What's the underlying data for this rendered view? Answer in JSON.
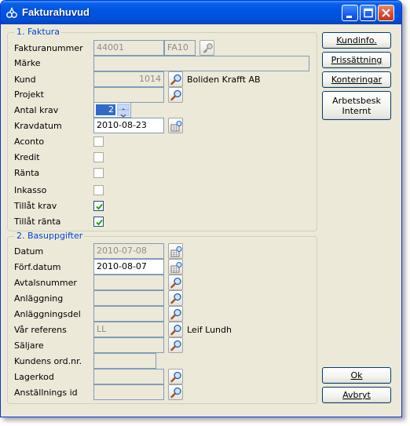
{
  "window": {
    "title": "Fakturahuvud"
  },
  "faktura": {
    "title": "1. Faktura",
    "fakturanummer": {
      "label": "Fakturanummer",
      "value": "44001",
      "series": "FA10"
    },
    "marke": {
      "label": "Märke",
      "value": ""
    },
    "kund": {
      "label": "Kund",
      "value": "1014",
      "name": "Boliden Krafft AB"
    },
    "projekt": {
      "label": "Projekt",
      "value": ""
    },
    "antal_krav": {
      "label": "Antal krav",
      "value": "2"
    },
    "kravdatum": {
      "label": "Kravdatum",
      "value": "2010-08-23"
    },
    "checkboxes": [
      {
        "label": "Aconto",
        "checked": false
      },
      {
        "label": "Kredit",
        "checked": false
      },
      {
        "label": "Ränta",
        "checked": false
      },
      {
        "label": "Inkasso",
        "checked": false
      },
      {
        "label": "Tillåt krav",
        "checked": true
      },
      {
        "label": "Tillåt ränta",
        "checked": true
      }
    ]
  },
  "basuppgifter": {
    "title": "2. Basuppgifter",
    "datum": {
      "label": "Datum",
      "value": "2010-07-08"
    },
    "forf_datum": {
      "label": "Förf.datum",
      "value": "2010-08-07"
    },
    "avtalsnummer": {
      "label": "Avtalsnummer",
      "value": ""
    },
    "anlaggning": {
      "label": "Anläggning",
      "value": ""
    },
    "anlaggningsdel": {
      "label": "Anläggningsdel",
      "value": ""
    },
    "var_referens": {
      "label": "Vår referens",
      "value": "LL",
      "name": "Leif Lundh"
    },
    "saljare": {
      "label": "Säljare",
      "value": ""
    },
    "kundens_ord": {
      "label": "Kundens ord.nr.",
      "value": ""
    },
    "lagerkod": {
      "label": "Lagerkod",
      "value": ""
    },
    "anstallnings_id": {
      "label": "Anställnings id",
      "value": ""
    }
  },
  "buttons": {
    "kundinfo": "Kundinfo.",
    "prissattning": "Prissättning",
    "konteringar": "Konteringar",
    "arbetsbesk_1": "Arbetsbesk",
    "arbetsbesk_2": "Internt",
    "ok": "Ok",
    "avbryt": "Avbryt"
  },
  "icons": {
    "app": "app-icon",
    "lookup": "magnifier-icon",
    "calendar": "calendar-icon",
    "key": "key-icon"
  }
}
